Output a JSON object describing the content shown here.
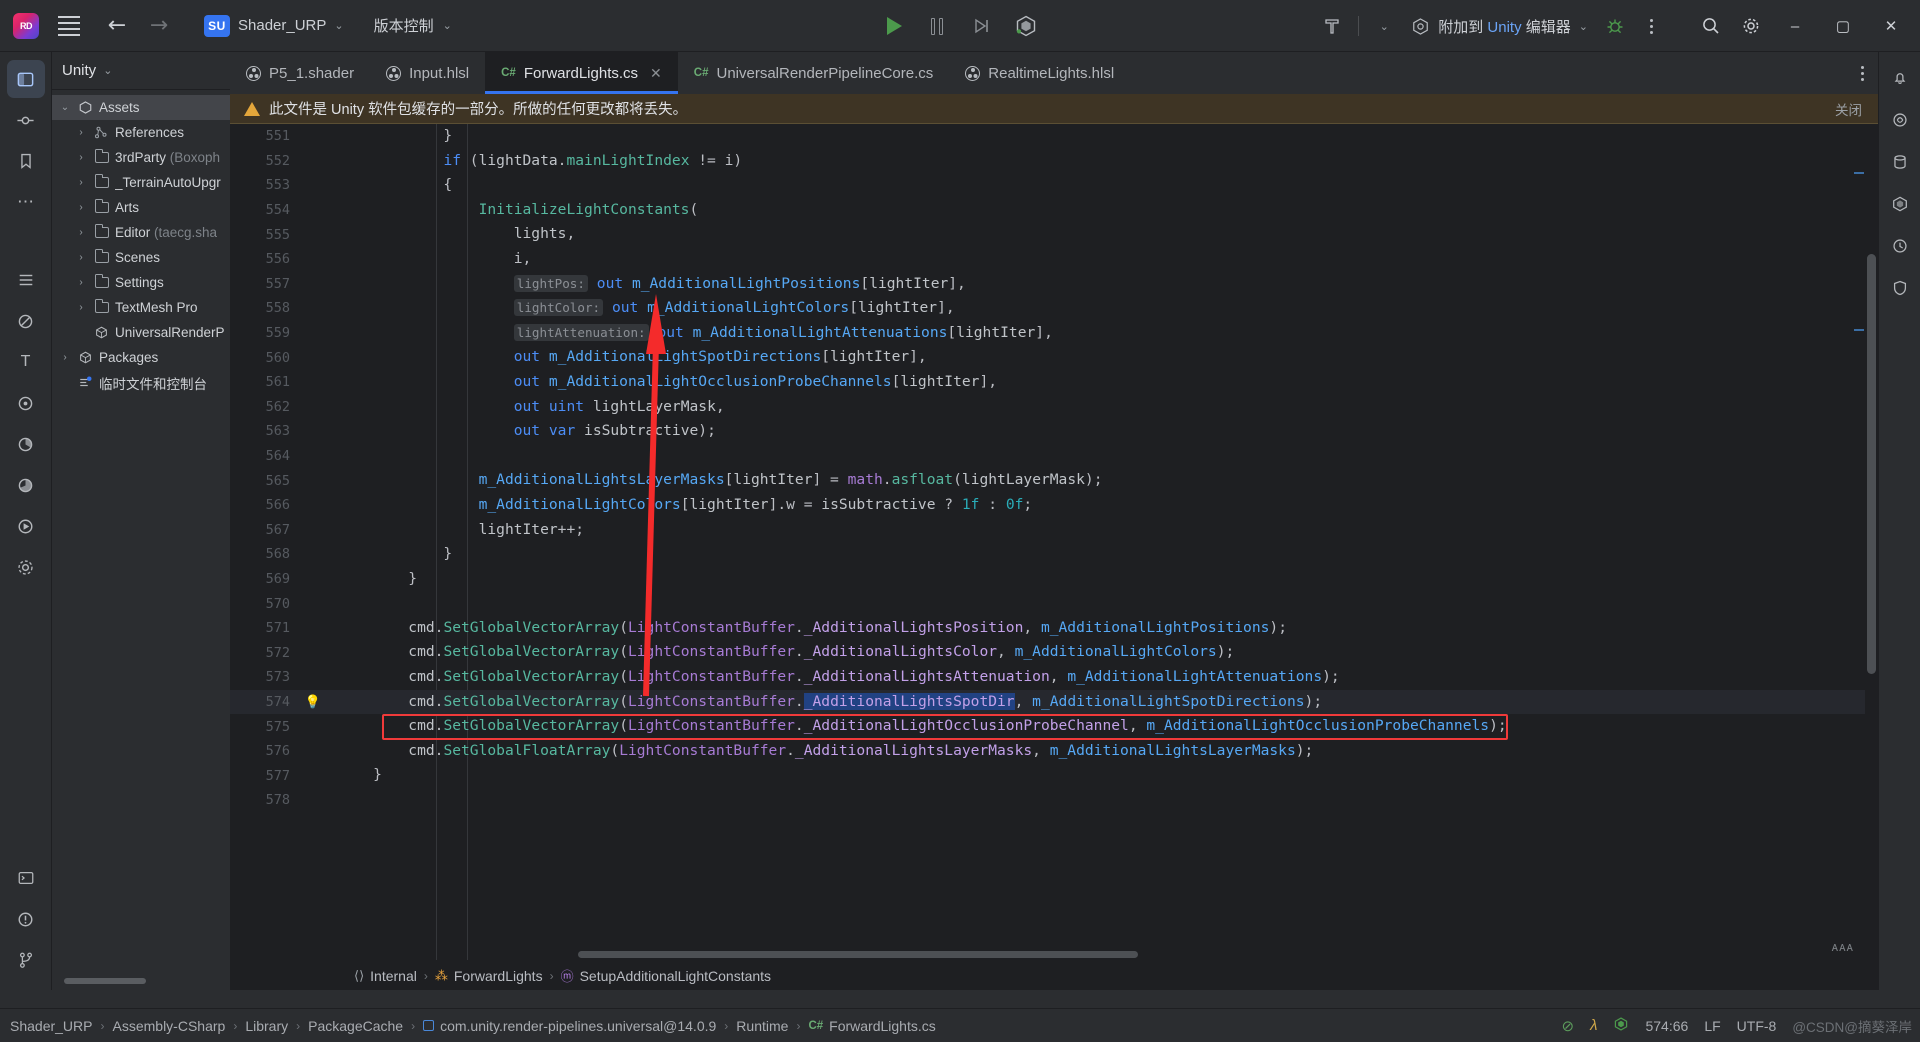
{
  "window": {
    "app_logo": "rider-logo-icon",
    "project_badge": "SU",
    "project_name": "Shader_URP",
    "vcs_label": "版本控制",
    "menu_icon": "hamburger-menu-icon",
    "back_icon": "back-arrow-icon",
    "forward_icon": "forward-arrow-icon"
  },
  "toolbar_center": {
    "run_icon": "run-play-icon",
    "pause_icon": "pause-icon",
    "step_icon": "step-over-icon",
    "unity_icon": "unity-logo-icon"
  },
  "toolbar_right": {
    "build_icon": "hammer-build-icon",
    "build_dropdown_icon": "chevron-down-icon",
    "attach_icon": "unity-attach-icon",
    "attach_label_pre": "附加到 ",
    "attach_label_blue": "Unity",
    "attach_label_post": " 编辑器",
    "attach_dropdown_icon": "chevron-down-icon",
    "debug_icon": "debug-bug-icon",
    "more_icon": "kebab-more-icon",
    "minimize": "‒",
    "maximize": "▢",
    "close": "✕"
  },
  "left_rail": {
    "items": [
      {
        "name": "project-tool-icon",
        "glyph": "▣",
        "active": true
      },
      {
        "name": "commit-tool-icon",
        "glyph": "⦿",
        "active": false
      },
      {
        "name": "bookmarks-tool-icon",
        "glyph": "🔖",
        "active": false
      },
      {
        "name": "more-tool-icon",
        "glyph": "⋯",
        "active": false
      },
      {
        "name": "structure-tool-icon",
        "glyph": "≡",
        "active": false
      },
      {
        "name": "unit-tests-tool-icon",
        "glyph": "⊘",
        "active": false
      },
      {
        "name": "nuget-tool-icon",
        "glyph": "T",
        "active": false
      },
      {
        "name": "inspections-tool-icon",
        "glyph": "◎",
        "active": false
      },
      {
        "name": "profiler-tool-icon",
        "glyph": "◔",
        "active": false
      },
      {
        "name": "coverage-tool-icon",
        "glyph": "◕",
        "active": false
      },
      {
        "name": "run-tool-icon",
        "glyph": "▷",
        "active": false
      },
      {
        "name": "services-tool-icon",
        "glyph": "❖",
        "active": false
      },
      {
        "name": "terminal-tool-icon",
        "glyph": "▭",
        "active": false
      },
      {
        "name": "problems-tool-icon",
        "glyph": "!",
        "active": false
      },
      {
        "name": "git-branch-tool-icon",
        "glyph": "⑃",
        "active": false
      }
    ]
  },
  "right_rail": {
    "items": [
      {
        "name": "notifications-icon",
        "glyph": "🔔"
      },
      {
        "name": "ai-assistant-icon",
        "glyph": "◎"
      },
      {
        "name": "database-icon",
        "glyph": "▤"
      },
      {
        "name": "unity-explorer-icon",
        "glyph": "◈"
      },
      {
        "name": "history-icon",
        "glyph": "↻"
      },
      {
        "name": "shield-icon",
        "glyph": "⛨"
      }
    ]
  },
  "project_panel": {
    "title": "Unity",
    "title_dropdown_icon": "chevron-down-icon",
    "tree": [
      {
        "label": "Assets",
        "suffix": "",
        "depth": 0,
        "icon": "unity-assets-icon",
        "twisty": "expanded",
        "selected": true
      },
      {
        "label": "References",
        "suffix": "",
        "depth": 1,
        "icon": "references-node-icon",
        "twisty": "collapsed",
        "selected": false
      },
      {
        "label": "3rdParty",
        "suffix": " (Boxoph",
        "depth": 1,
        "icon": "folder-icon",
        "twisty": "collapsed",
        "selected": false
      },
      {
        "label": "_TerrainAutoUpgr",
        "suffix": "",
        "depth": 1,
        "icon": "folder-icon",
        "twisty": "collapsed",
        "selected": false
      },
      {
        "label": "Arts",
        "suffix": "",
        "depth": 1,
        "icon": "folder-icon",
        "twisty": "collapsed",
        "selected": false
      },
      {
        "label": "Editor",
        "suffix": " (taecg.sha",
        "depth": 1,
        "icon": "folder-code-icon",
        "twisty": "collapsed",
        "selected": false
      },
      {
        "label": "Scenes",
        "suffix": "",
        "depth": 1,
        "icon": "folder-icon",
        "twisty": "collapsed",
        "selected": false
      },
      {
        "label": "Settings",
        "suffix": "",
        "depth": 1,
        "icon": "folder-icon",
        "twisty": "collapsed",
        "selected": false
      },
      {
        "label": "TextMesh Pro",
        "suffix": "",
        "depth": 1,
        "icon": "folder-icon",
        "twisty": "collapsed",
        "selected": false
      },
      {
        "label": "UniversalRenderP",
        "suffix": "",
        "depth": 1,
        "icon": "package-icon",
        "twisty": "none",
        "selected": false
      },
      {
        "label": "Packages",
        "suffix": "",
        "depth": 0,
        "icon": "packages-icon",
        "twisty": "collapsed",
        "selected": false
      },
      {
        "label": "临时文件和控制台",
        "suffix": "",
        "depth": 0,
        "icon": "scratches-icon",
        "twisty": "none",
        "selected": false
      }
    ]
  },
  "tabs": [
    {
      "label": "P5_1.shader",
      "icon": "shader-file-icon",
      "active": false,
      "closable": false
    },
    {
      "label": "Input.hlsl",
      "icon": "shader-file-icon",
      "active": false,
      "closable": false
    },
    {
      "label": "ForwardLights.cs",
      "icon": "csharp-file-icon",
      "active": true,
      "closable": true
    },
    {
      "label": "UniversalRenderPipelineCore.cs",
      "icon": "csharp-file-icon",
      "active": false,
      "closable": false
    },
    {
      "label": "RealtimeLights.hlsl",
      "icon": "shader-file-icon",
      "active": false,
      "closable": false
    }
  ],
  "tab_overflow_icon": "kebab-more-icon",
  "notification": {
    "icon": "warning-triangle-icon",
    "text": "此文件是 Unity 软件包缓存的一部分。所做的任何更改都将丢失。",
    "close_label": "关闭"
  },
  "code": {
    "lines": [
      {
        "n": 551,
        "text": "            }",
        "indent": 0
      },
      {
        "n": 552,
        "text": "            if (lightData.mainLightIndex != i)"
      },
      {
        "n": 553,
        "text": "            {"
      },
      {
        "n": 554,
        "text": "                InitializeLightConstants("
      },
      {
        "n": 555,
        "text": "                    lights,"
      },
      {
        "n": 556,
        "text": "                    i,"
      },
      {
        "n": 557,
        "text": "                    lightPos: out m_AdditionalLightPositions[lightIter],"
      },
      {
        "n": 558,
        "text": "                    lightColor: out m_AdditionalLightColors[lightIter],"
      },
      {
        "n": 559,
        "text": "                    lightAttenuation: out m_AdditionalLightAttenuations[lightIter],"
      },
      {
        "n": 560,
        "text": "                    out m_AdditionalLightSpotDirections[lightIter],"
      },
      {
        "n": 561,
        "text": "                    out m_AdditionalLightOcclusionProbeChannels[lightIter],"
      },
      {
        "n": 562,
        "text": "                    out uint lightLayerMask,"
      },
      {
        "n": 563,
        "text": "                    out var isSubtractive);"
      },
      {
        "n": 564,
        "text": ""
      },
      {
        "n": 565,
        "text": "                m_AdditionalLightsLayerMasks[lightIter] = math.asfloat(lightLayerMask);"
      },
      {
        "n": 566,
        "text": "                m_AdditionalLightColors[lightIter].w = isSubtractive ? 1f : 0f;"
      },
      {
        "n": 567,
        "text": "                lightIter++;"
      },
      {
        "n": 568,
        "text": "            }"
      },
      {
        "n": 569,
        "text": "        }"
      },
      {
        "n": 570,
        "text": ""
      },
      {
        "n": 571,
        "text": "        cmd.SetGlobalVectorArray(LightConstantBuffer._AdditionalLightsPosition, m_AdditionalLightPositions);"
      },
      {
        "n": 572,
        "text": "        cmd.SetGlobalVectorArray(LightConstantBuffer._AdditionalLightsColor, m_AdditionalLightColors);"
      },
      {
        "n": 573,
        "text": "        cmd.SetGlobalVectorArray(LightConstantBuffer._AdditionalLightsAttenuation, m_AdditionalLightAttenuations);"
      },
      {
        "n": 574,
        "text": "        cmd.SetGlobalVectorArray(LightConstantBuffer._AdditionalLightsSpotDir, m_AdditionalLightSpotDirections);",
        "current": true,
        "bulb": true,
        "boxed": true
      },
      {
        "n": 575,
        "text": "        cmd.SetGlobalVectorArray(LightConstantBuffer._AdditionalLightOcclusionProbeChannel, m_AdditionalLightOcclusionProbeChannels);"
      },
      {
        "n": 576,
        "text": "        cmd.SetGlobalFloatArray(LightConstantBuffer._AdditionalLightsLayerMasks, m_AdditionalLightsLayerMasks);"
      },
      {
        "n": 577,
        "text": "    }"
      },
      {
        "n": 578,
        "text": ""
      }
    ],
    "annotation": "red-arrow-annotation",
    "highlight_color": "#f03a3a",
    "selected_token": "_AdditionalLightsSpotDir"
  },
  "breadcrumbs_editor": [
    {
      "label": "Internal",
      "icon": "namespace-icon"
    },
    {
      "label": "ForwardLights",
      "icon": "class-icon"
    },
    {
      "label": "SetupAdditionalLightConstants",
      "icon": "method-icon"
    }
  ],
  "minimap_label": "ᴀᴀᴀ",
  "statusbar": {
    "path": [
      {
        "label": "Shader_URP",
        "icon": ""
      },
      {
        "label": "Assembly-CSharp",
        "icon": ""
      },
      {
        "label": "Library",
        "icon": ""
      },
      {
        "label": "PackageCache",
        "icon": ""
      },
      {
        "label": "com.unity.render-pipelines.universal@14.0.9",
        "icon": "module-icon"
      },
      {
        "label": "Runtime",
        "icon": ""
      },
      {
        "label": "ForwardLights.cs",
        "icon": "csharp-file-icon"
      }
    ],
    "right": {
      "inspection_icon": "inspection-ok-icon",
      "lambda_icon": "lambda-icon",
      "unity_icon": "unity-logo-icon",
      "caret": "574:66",
      "line_sep": "LF",
      "encoding": "UTF-8",
      "lock_icon": "lock-icon",
      "watermark": "@CSDN@摘葵泽岸"
    }
  },
  "colors": {
    "accent": "#3574f0",
    "warn_bg": "#3e3424",
    "highlight": "#f03a3a",
    "bg": "#2b2d30",
    "editor_bg": "#1e1f22"
  }
}
